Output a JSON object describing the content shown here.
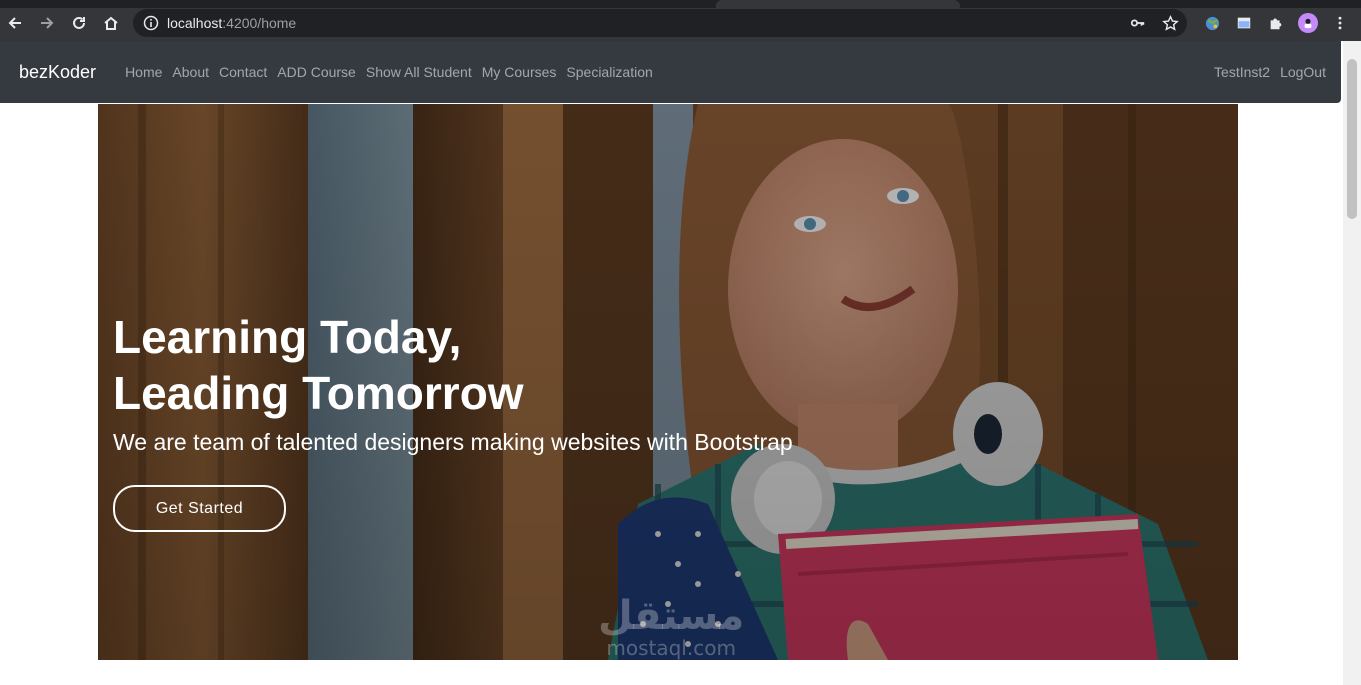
{
  "browser": {
    "url_host": "localhost",
    "url_path": ":4200/home"
  },
  "navbar": {
    "brand": "bezKoder",
    "links": [
      {
        "label": "Home"
      },
      {
        "label": "About"
      },
      {
        "label": "Contact"
      },
      {
        "label": "ADD Course"
      },
      {
        "label": "Show All Student"
      },
      {
        "label": "My Courses"
      },
      {
        "label": "Specialization"
      }
    ],
    "user": "TestInst2",
    "logout": "LogOut"
  },
  "hero": {
    "title_line1": "Learning Today,",
    "title_line2": "Leading Tomorrow",
    "subtitle": "We are team of talented designers making websites with Bootstrap",
    "cta": "Get Started",
    "background": "student with headphones and pink folder in front of wooden wall"
  },
  "watermark": {
    "arabic": "مستقل",
    "latin": "mostaql.com"
  },
  "colors": {
    "navbar_bg": "#343a40",
    "browser_toolbar": "#35363a",
    "omnibox_bg": "#202124"
  }
}
